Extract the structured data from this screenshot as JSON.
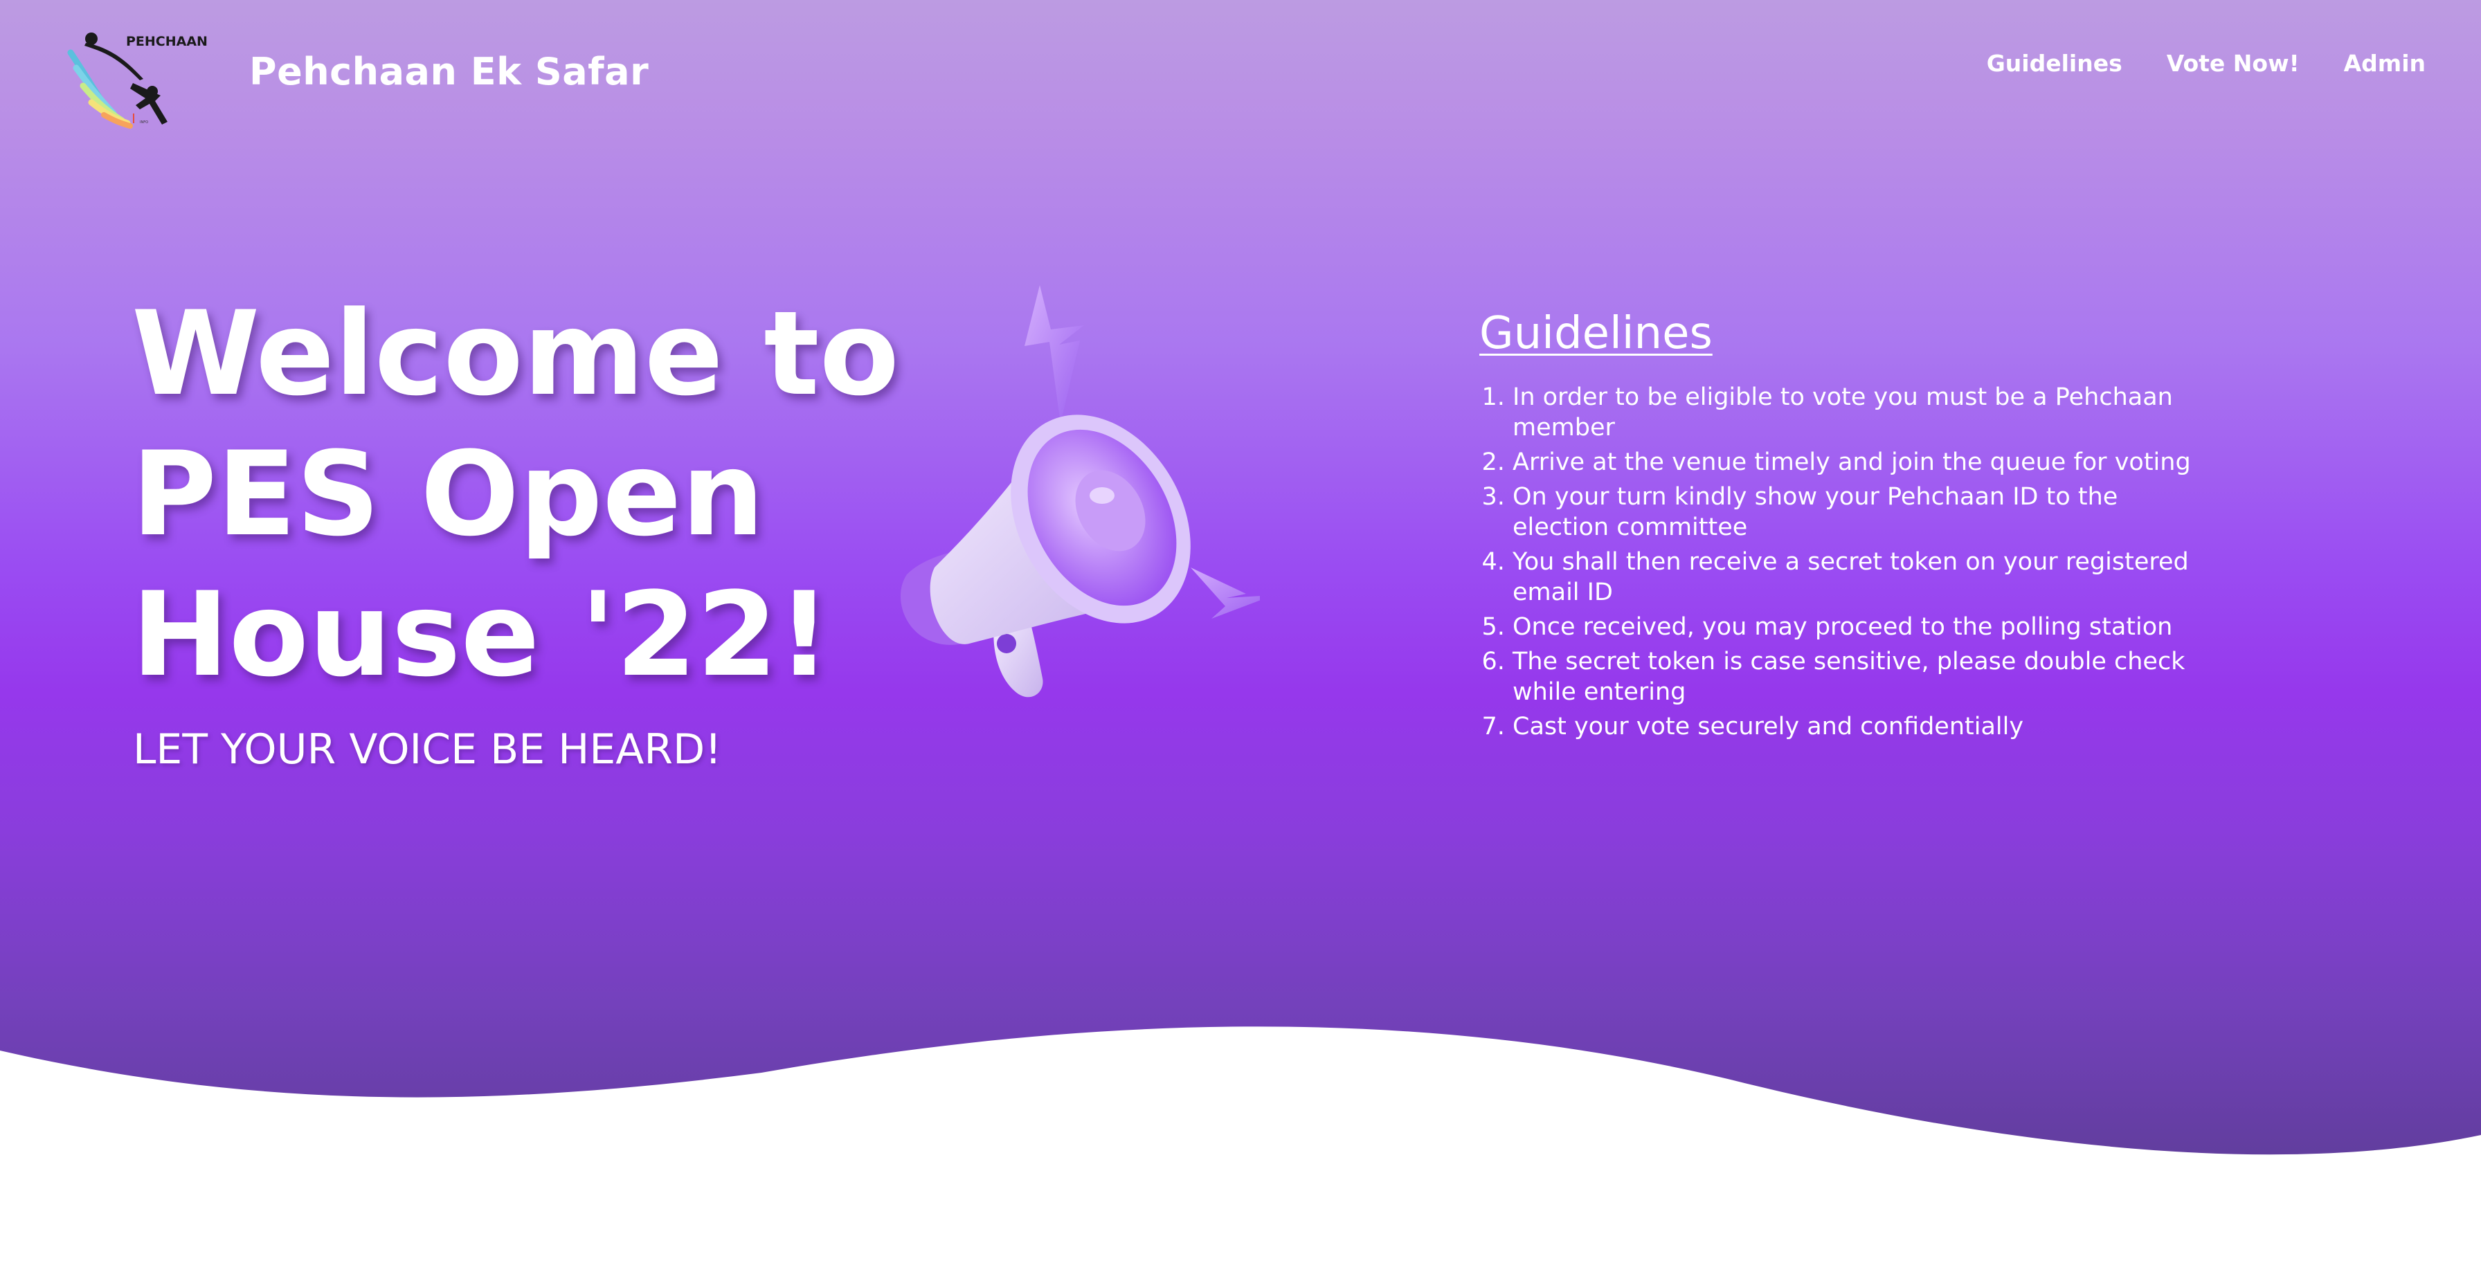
{
  "header": {
    "brand_title": "Pehchaan Ek Safar",
    "logo_text": "PEHCHAAN",
    "nav": [
      {
        "label": "Guidelines"
      },
      {
        "label": "Vote Now!"
      },
      {
        "label": "Admin"
      }
    ]
  },
  "hero": {
    "welcome_title": "Welcome to PES Open House '22!",
    "tagline": "LET YOUR VOICE BE HEARD!",
    "illustration": "megaphone-icon"
  },
  "guidelines": {
    "title": "Guidelines",
    "items": [
      "In order to be eligible to vote you must be a Pehchaan member",
      "Arrive at the venue timely and join the queue for voting",
      "On your turn kindly show your Pehchaan ID to the election committee",
      "You shall then receive a secret token on your registered email ID",
      "Once received, you may proceed to the polling station",
      "The secret token is case sensitive, please double check while entering",
      "Cast your vote securely and confidentially"
    ]
  },
  "colors": {
    "gradient_top": "#bc9be2",
    "gradient_mid": "#9638ec",
    "gradient_bottom": "#5f3d9a",
    "text": "#ffffff"
  }
}
